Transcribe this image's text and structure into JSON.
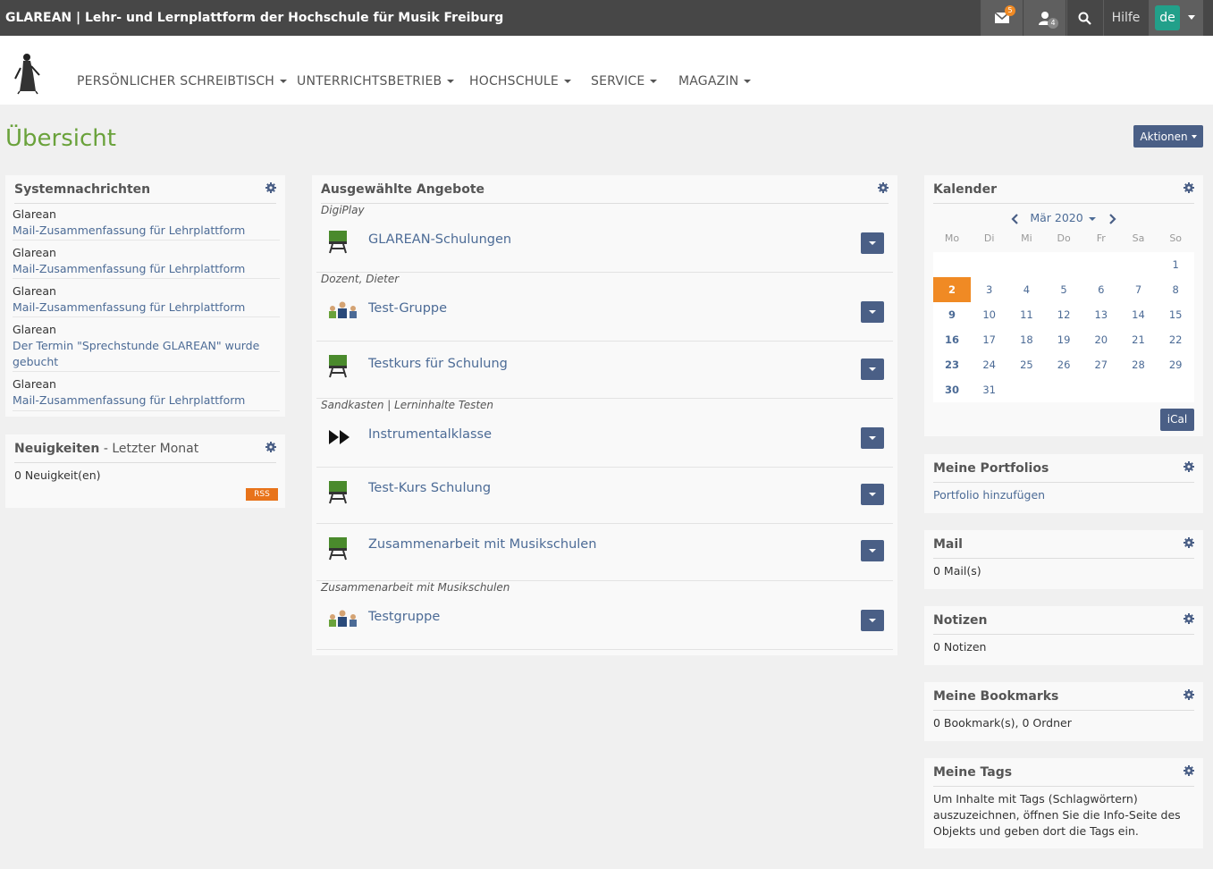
{
  "app": {
    "title": "GLAREAN | Lehr- und Lernplattform der Hochschule für Musik Freiburg"
  },
  "topbar": {
    "mail_badge": "5",
    "user_badge": "4",
    "help": "Hilfe",
    "lang": "de"
  },
  "nav": {
    "items": [
      "PERSÖNLICHER SCHREIBTISCH",
      "UNTERRICHTSBETRIEB",
      "HOCHSCHULE",
      "SERVICE",
      "MAGAZIN"
    ]
  },
  "page": {
    "title": "Übersicht",
    "actions": "Aktionen"
  },
  "system_news": {
    "title": "Systemnachrichten",
    "items": [
      {
        "who": "Glarean",
        "what": "Mail-Zusammenfassung für Lehrplattform"
      },
      {
        "who": "Glarean",
        "what": "Mail-Zusammenfassung für Lehrplattform"
      },
      {
        "who": "Glarean",
        "what": "Mail-Zusammenfassung für Lehrplattform"
      },
      {
        "who": "Glarean",
        "what": "Der Termin \"Sprechstunde GLAREAN\" wurde gebucht"
      },
      {
        "who": "Glarean",
        "what": "Mail-Zusammenfassung für Lehrplattform"
      }
    ]
  },
  "news": {
    "title": "Neuigkeiten",
    "subtitle": " - Letzter Monat",
    "count": "0 Neuigkeit(en)",
    "rss": "RSS"
  },
  "courses": {
    "title": "Ausgewählte Angebote",
    "groups": [
      "DigiPlay",
      "Dozent, Dieter",
      "Sandkasten | Lerninhalte Testen",
      "Zusammenarbeit mit Musikschulen"
    ],
    "items": [
      "GLAREAN-Schulungen",
      "Test-Gruppe",
      "Testkurs für Schulung",
      "Instrumentalklasse",
      "Test-Kurs Schulung",
      "Zusammenarbeit mit Musikschulen",
      "Testgruppe"
    ]
  },
  "calendar": {
    "title": "Kalender",
    "month": "Mär 2020",
    "dow": [
      "Mo",
      "Di",
      "Mi",
      "Do",
      "Fr",
      "Sa",
      "So"
    ],
    "weeks": [
      [
        "",
        "",
        "",
        "",
        "",
        "",
        "1"
      ],
      [
        "2",
        "3",
        "4",
        "5",
        "6",
        "7",
        "8"
      ],
      [
        "9",
        "10",
        "11",
        "12",
        "13",
        "14",
        "15"
      ],
      [
        "16",
        "17",
        "18",
        "19",
        "20",
        "21",
        "22"
      ],
      [
        "23",
        "24",
        "25",
        "26",
        "27",
        "28",
        "29"
      ],
      [
        "30",
        "31",
        "",
        "",
        "",
        "",
        ""
      ]
    ],
    "today": "2",
    "ical": "iCal"
  },
  "portfolios": {
    "title": "Meine Portfolios",
    "link": "Portfolio hinzufügen"
  },
  "mail": {
    "title": "Mail",
    "text": "0 Mail(s)"
  },
  "notes": {
    "title": "Notizen",
    "text": "0 Notizen"
  },
  "bookmarks": {
    "title": "Meine Bookmarks",
    "text": "0 Bookmark(s), 0 Ordner"
  },
  "tags": {
    "title": "Meine Tags",
    "text": "Um Inhalte mit Tags (Schlagwörtern) auszuzeichnen, öffnen Sie die Info-Seite des Objekts und geben dort die Tags ein."
  },
  "colors": {
    "accent": "#6aa23b",
    "button": "#4a5f86",
    "today": "#f08a24",
    "link": "#4c6b96"
  }
}
